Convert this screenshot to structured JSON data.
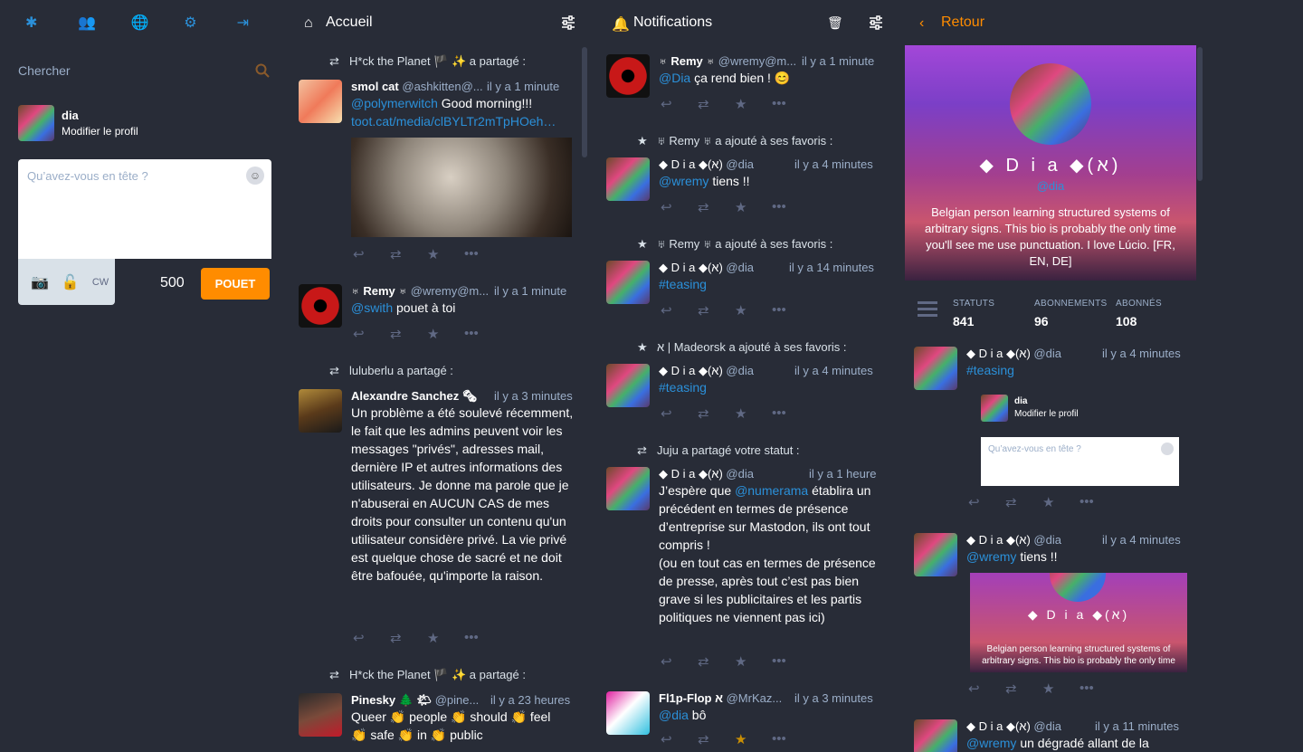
{
  "nav": {
    "icons": [
      "asterisk-icon",
      "users-icon",
      "globe-icon",
      "gear-icon",
      "logout-icon"
    ]
  },
  "search": {
    "placeholder": "Chercher"
  },
  "me": {
    "name": "dia",
    "edit": "Modifier le profil"
  },
  "compose": {
    "placeholder": "Qu’avez-vous en tête ?",
    "cw": "CW",
    "count": "500",
    "submit": "POUET"
  },
  "home": {
    "title": "Accueil",
    "items": [
      {
        "boost": "H*ck the Planet 🏴 ✨ a partagé :",
        "name": "smol cat",
        "acct": "@ashkitten@...",
        "time": "il y a 1 minute",
        "mention": "@polymerwitch",
        "text": " Good morning!!!",
        "link": "toot.cat/media/clBYLTr2mTpHOeh…"
      },
      {
        "name": "♅ Remy ♅",
        "acct": "@wremy@m...",
        "time": "il y a 1 minute",
        "mention": "@swith",
        "text": " pouet à toi"
      },
      {
        "boost": "luluberlu a partagé :",
        "name": "Alexandre Sanchez 🗞",
        "time": "il y a 3 minutes",
        "text": "Un problème a été soulevé récemment, le fait que les admins peuvent voir les messages \"privés\", adresses mail, dernière IP et autres informations des utilisateurs. Je donne ma parole que je n'abuserai en AUCUN CAS de mes droits pour consulter un contenu qu'un utilisateur considère privé. La vie privé est quelque chose de sacré et ne doit être bafouée, qu'importe la raison."
      },
      {
        "boost": "H*ck the Planet 🏴 ✨ a partagé :",
        "name": "Pinesky 🌲 🌤",
        "acct": "@pine...",
        "time": "il y a 23 heures",
        "line1": "Queer 👏 people 👏 should 👏 feel",
        "line2": "👏 safe 👏 in 👏 public"
      }
    ]
  },
  "notifications": {
    "title": "Notifications",
    "items": [
      {
        "name": "♅ Remy ♅",
        "acct": "@wremy@m...",
        "time": "il y a 1 minute",
        "mention": "@Dia",
        "text": " ça rend bien ! 😊"
      },
      {
        "label": "♅ Remy ♅ a ajouté à ses favoris :",
        "name": "◆ D i a ◆(א)",
        "acct": "@dia",
        "time": "il y a 4 minutes",
        "mention": "@wremy",
        "text": "  tiens !!"
      },
      {
        "label": "♅ Remy ♅ a ajouté à ses favoris :",
        "name": "◆ D i a ◆(א)",
        "acct": "@dia",
        "time": "il y a 14 minutes",
        "mention": "#teasing",
        "text": ""
      },
      {
        "label": "א | Madeorsk a ajouté à ses favoris :",
        "name": "◆ D i a ◆(א)",
        "acct": "@dia",
        "time": "il y a 4 minutes",
        "mention": "#teasing",
        "text": ""
      },
      {
        "label": "Juju a partagé votre statut :",
        "name": "◆ D i a ◆(א)",
        "acct": "@dia",
        "time": "il y a 1 heure",
        "pre": "J’espère que ",
        "mention": "@numerama",
        "text": " établira un précédent en termes de présence d’entreprise sur Mastodon, ils ont tout compris !",
        "text2": "(ou en tout cas en termes de présence de presse, après tout c’est pas bien grave si les publicitaires et les partis politiques ne viennent pas ici)"
      },
      {
        "name": "Fl1p-Flop א",
        "acct": "@MrKaz...",
        "time": "il y a 3 minutes",
        "mention": "@dia",
        "text": " bô"
      }
    ]
  },
  "profile": {
    "back": "Retour",
    "name": "◆ D i a ◆(א)",
    "acct": "@dia",
    "bio": "Belgian person learning structured systems of arbitrary signs. This bio is probably the only time you'll see me use punctuation. I love Lúcio. [FR, EN, DE]",
    "stats": [
      {
        "label": "STATUTS",
        "value": "841"
      },
      {
        "label": "ABONNEMENTS",
        "value": "96"
      },
      {
        "label": "ABONNÉS",
        "value": "108"
      }
    ],
    "items": [
      {
        "name": "◆ D i a ◆(א)",
        "acct": "@dia",
        "time": "il y a 4 minutes",
        "mention": "#teasing",
        "mini_name": "dia",
        "mini_edit": "Modifier le profil",
        "mini_ph": "Qu’avez-vous en tête ?"
      },
      {
        "name": "◆ D i a ◆(א)",
        "acct": "@dia",
        "time": "il y a 4 minutes",
        "mention": "@wremy",
        "text": "  tiens !!",
        "mini_name": "◆ D i a ◆(א)",
        "mini_bio": "Belgian person learning structured systems of arbitrary signs. This bio is probably the only time"
      },
      {
        "name": "◆ D i a ◆(א)",
        "acct": "@dia",
        "time": "il y a 11 minutes",
        "mention": "@wremy",
        "text": " un dégradé allant de la"
      }
    ]
  },
  "colors": {
    "bg": "#282c37",
    "accent": "#2b90d9",
    "button": "#ff8c00",
    "muted": "#9baec8",
    "star": "#ca8f04"
  }
}
